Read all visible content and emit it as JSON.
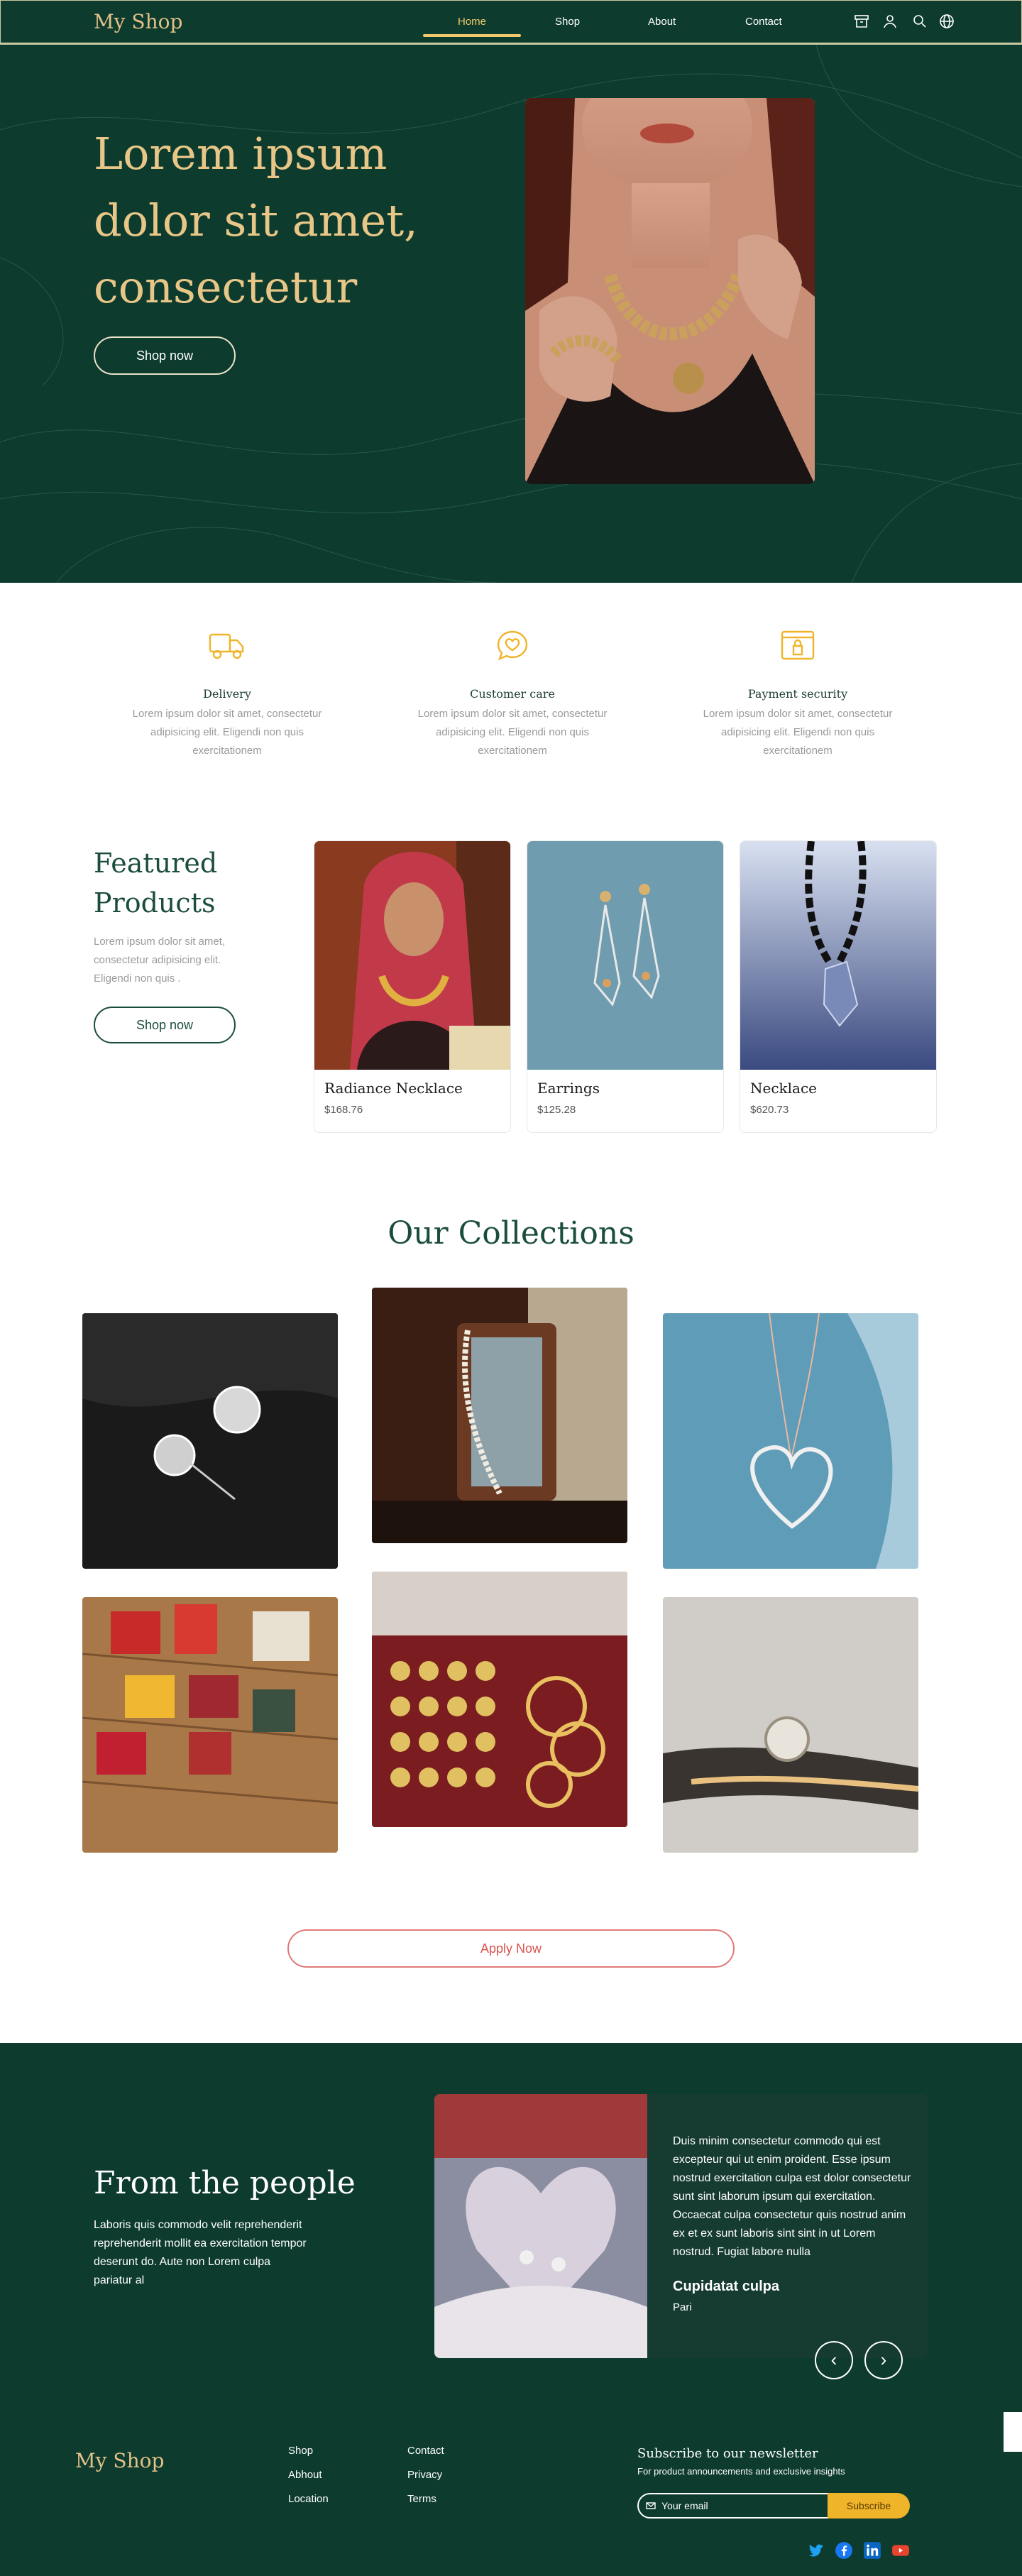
{
  "nav": {
    "logo": "My Shop",
    "links": [
      "Home",
      "Shop",
      "About",
      "Contact"
    ],
    "active": "Home",
    "icons": [
      "archive-icon",
      "user-icon",
      "search-icon",
      "globe-icon"
    ]
  },
  "hero": {
    "title": "Lorem ipsum dolor sit amet, consectetur",
    "button": "Shop now"
  },
  "features": [
    {
      "icon": "delivery-truck-icon",
      "title": "Delivery",
      "text": "Lorem ipsum dolor sit amet, consectetur adipisicing elit. Eligendi non quis exercitationem"
    },
    {
      "icon": "customer-care-heart-icon",
      "title": "Customer care",
      "text": "Lorem ipsum dolor sit amet, consectetur adipisicing elit. Eligendi non quis exercitationem"
    },
    {
      "icon": "payment-security-icon",
      "title": "Payment security",
      "text": "Lorem ipsum dolor sit amet, consectetur adipisicing elit. Eligendi non quis exercitationem"
    }
  ],
  "featured": {
    "title": "Featured Products",
    "text": "Lorem ipsum dolor sit amet, consectetur adipisicing elit. Eligendi non quis .",
    "button": "Shop now",
    "products": [
      {
        "name": "Radiance Necklace",
        "price": "$168.76"
      },
      {
        "name": "Earrings",
        "price": "$125.28"
      },
      {
        "name": "Necklace",
        "price": "$620.73"
      }
    ]
  },
  "collections": {
    "title": "Our Collections",
    "button": "Apply Now"
  },
  "testimonial": {
    "title": "From the people",
    "text": "Laboris quis commodo velit reprehenderit reprehenderit mollit ea exercitation tempor deserunt do. Aute non Lorem culpa pariatur al",
    "quote": "Duis minim consectetur commodo qui est excepteur qui ut enim proident. Esse ipsum nostrud exercitation culpa est dolor consectetur sunt sint laborum ipsum qui exercitation. Occaecat culpa consectetur quis nostrud anim ex et ex sunt laboris sint sint in ut Lorem nostrud. Fugiat labore nulla",
    "name": "Cupidatat culpa",
    "role": "Pari",
    "prev": "‹",
    "next": "›"
  },
  "footer": {
    "logo": "My Shop",
    "col1": [
      "Shop",
      "Abhout",
      "Location"
    ],
    "col2": [
      "Contact",
      "Privacy",
      "Terms"
    ],
    "newsletter_title": "Subscribe to our newsletter",
    "newsletter_sub": "For product announcements and exclusive insights",
    "email_placeholder": "Your email",
    "subscribe": "Subscribe",
    "socials": [
      "twitter-icon",
      "facebook-icon",
      "linkedin-icon",
      "youtube-icon"
    ]
  },
  "colors": {
    "brand_green": "#0d3b2e",
    "gold": "#e8c687",
    "accent_yellow": "#f0b42a",
    "apply_red": "#d9534f"
  }
}
